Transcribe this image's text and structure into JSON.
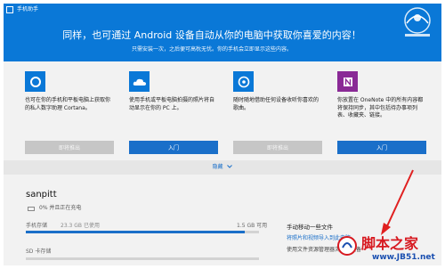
{
  "window": {
    "title": "手机助手"
  },
  "header": {
    "headline": "同样，也可通过 Android 设备自动从你的电脑中获取你喜爱的内容！",
    "subline": "只需安装一次，之后便可高枕无忧。你的手机会立即显示这些内容。",
    "logo_icon": "logo-badge"
  },
  "cards": [
    {
      "icon": "cortana-icon",
      "description": "也可在你的手机和平板电脑上获取你的私人数字助理 Cortana。",
      "button_label": "即将推出",
      "button_enabled": false
    },
    {
      "icon": "onedrive-icon",
      "description": "使用手机或平板电脑拍摄的照片将自动显示在你的 PC 上。",
      "button_label": "入门",
      "button_enabled": true
    },
    {
      "icon": "music-icon",
      "description": "随时随地借助任何设备收听你喜欢的歌曲。",
      "button_label": "即将推出",
      "button_enabled": false
    },
    {
      "icon": "onenote-icon",
      "description": "你放置在 OneNote 中的所有内容都将保持同步，其中包括待办事项列表、收藏夹、链接。",
      "button_label": "入门",
      "button_enabled": true
    }
  ],
  "collapse": {
    "label": "隐藏",
    "icon": "chevron-down-icon"
  },
  "device": {
    "name": "sanpitt",
    "battery_text": "0% 并且正在充电",
    "storage_label": "手机存储",
    "storage_used": "23.3 GB 已使用",
    "storage_total": "1.5 GB 可用",
    "storage_fraction": 0.94,
    "sd_label": "SD 卡存储"
  },
  "side_panel": {
    "title": "手动移动一些文件",
    "link": "将照片和视频导入到此电脑",
    "text": "使用文件资源管理器浏览此设备"
  },
  "watermark": {
    "brand": "脚本之家",
    "url": "www.JB51.net"
  },
  "colors": {
    "accent": "#0a78d7",
    "button": "#1a6fc9",
    "disabled": "#c6c6c6",
    "annotation_arrow": "#e02020"
  }
}
